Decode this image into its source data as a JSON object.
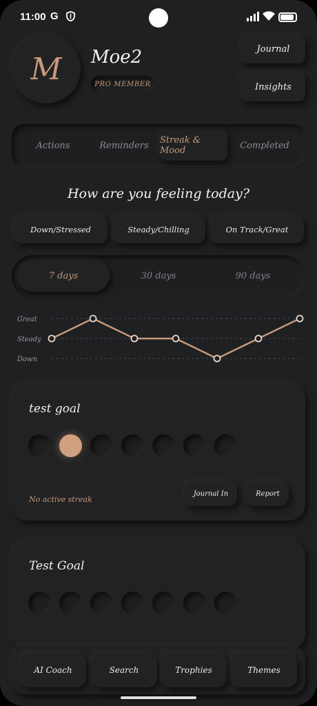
{
  "status_bar": {
    "time": "11:00",
    "g_label": "G",
    "icons": [
      "shield-icon",
      "signal-icon",
      "wifi-icon",
      "battery-icon"
    ]
  },
  "profile": {
    "initial": "M",
    "username": "Moe2",
    "badge": "PRO MEMBER"
  },
  "header_buttons": {
    "journal": "Journal",
    "insights": "Insights"
  },
  "tabs": [
    {
      "label": "Actions",
      "active": false
    },
    {
      "label": "Reminders",
      "active": false
    },
    {
      "label": "Streak & Mood",
      "active": true
    },
    {
      "label": "Completed",
      "active": false
    }
  ],
  "question": "How are you feeling today?",
  "moods": [
    "Down/Stressed",
    "Steady/Chilling",
    "On Track/Great"
  ],
  "periods": [
    {
      "label": "7 days",
      "active": true
    },
    {
      "label": "30 days",
      "active": false
    },
    {
      "label": "90 days",
      "active": false
    }
  ],
  "chart_data": {
    "type": "line",
    "y_categories": [
      "Down",
      "Steady",
      "Great"
    ],
    "series": [
      {
        "values": [
          "Steady",
          "Great",
          "Steady",
          "Steady",
          "Down",
          "Steady",
          "Great"
        ]
      }
    ],
    "grid": true
  },
  "goals": [
    {
      "title": "test goal",
      "days_done": [
        false,
        true,
        false,
        false,
        false,
        false,
        false
      ],
      "streak_text": "No active streak",
      "buttons": [
        "Journal In",
        "Report"
      ]
    },
    {
      "title": "Test Goal",
      "days_done": [
        false,
        false,
        false,
        false,
        false,
        false,
        false
      ]
    }
  ],
  "bottom_nav": [
    "AI Coach",
    "Search",
    "Trophies",
    "Themes"
  ],
  "colors": {
    "background": "#1f2022",
    "accent": "#c7987a",
    "text": "#f1f1f1",
    "muted": "#8e8e92"
  }
}
